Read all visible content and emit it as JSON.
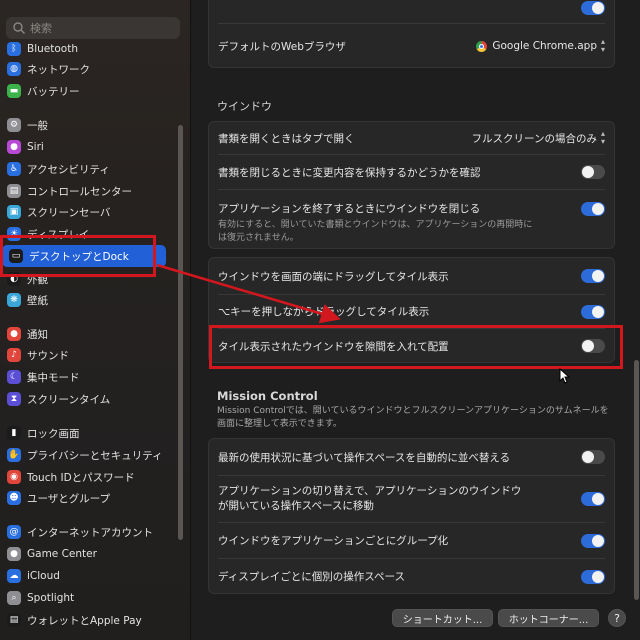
{
  "search": {
    "placeholder": "検索"
  },
  "sidebar": {
    "items": [
      {
        "label": "Bluetooth",
        "icon": "bluetooth-icon",
        "color": "#2a6fe0"
      },
      {
        "label": "ネットワーク",
        "icon": "network-icon",
        "color": "#2a6fe0"
      },
      {
        "label": "バッテリー",
        "icon": "battery-icon",
        "color": "#3cb34a"
      },
      {
        "label": "一般",
        "icon": "gear-icon",
        "color": "#8e8e93"
      },
      {
        "label": "Siri",
        "icon": "siri-icon",
        "color": "#b84ad6"
      },
      {
        "label": "アクセシビリティ",
        "icon": "accessibility-icon",
        "color": "#2a6fe0"
      },
      {
        "label": "コントロールセンター",
        "icon": "control-center-icon",
        "color": "#8e8e93"
      },
      {
        "label": "スクリーンセーバ",
        "icon": "screensaver-icon",
        "color": "#3aa7d8"
      },
      {
        "label": "ディスプレイ",
        "icon": "display-icon",
        "color": "#2a6fe0"
      },
      {
        "label": "デスクトップとDock",
        "icon": "dock-icon",
        "color": "#1b1b1b"
      },
      {
        "label": "外観",
        "icon": "appearance-icon",
        "color": "#1b1b1b"
      },
      {
        "label": "壁紙",
        "icon": "wallpaper-icon",
        "color": "#3aa7d8"
      },
      {
        "label": "通知",
        "icon": "notifications-icon",
        "color": "#e0463b"
      },
      {
        "label": "サウンド",
        "icon": "sound-icon",
        "color": "#e0463b"
      },
      {
        "label": "集中モード",
        "icon": "focus-icon",
        "color": "#5b4fd6"
      },
      {
        "label": "スクリーンタイム",
        "icon": "screentime-icon",
        "color": "#5b4fd6"
      },
      {
        "label": "ロック画面",
        "icon": "lock-screen-icon",
        "color": "#1b1b1b"
      },
      {
        "label": "プライバシーとセキュリティ",
        "icon": "privacy-icon",
        "color": "#2a6fe0"
      },
      {
        "label": "Touch IDとパスワード",
        "icon": "touchid-icon",
        "color": "#e0463b"
      },
      {
        "label": "ユーザとグループ",
        "icon": "users-icon",
        "color": "#2a6fe0"
      },
      {
        "label": "インターネットアカウント",
        "icon": "internet-accounts-icon",
        "color": "#2a6fe0"
      },
      {
        "label": "Game Center",
        "icon": "game-center-icon",
        "color": "#8e8e93"
      },
      {
        "label": "iCloud",
        "icon": "icloud-icon",
        "color": "#2a6fe0"
      },
      {
        "label": "Spotlight",
        "icon": "spotlight-icon",
        "color": "#8e8e93"
      },
      {
        "label": "ウォレットとApple Pay",
        "icon": "wallet-icon",
        "color": "#1b1b1b"
      }
    ]
  },
  "top_group": {
    "browser_label": "デフォルトのWebブラウザ",
    "browser_value": "Google Chrome.app"
  },
  "windows_section": {
    "title": "ウインドウ",
    "open_tabs_label": "書類を開くときはタブで開く",
    "open_tabs_value": "フルスクリーンの場合のみ",
    "ask_keep_changes_label": "書類を閉じるときに変更内容を保持するかどうかを確認",
    "ask_keep_changes": false,
    "close_windows_label": "アプリケーションを終了するときにウインドウを閉じる",
    "close_windows_desc": "有効にすると、開いていた書類とウインドウは、アプリケーションの再開時には復元されません。",
    "close_windows": true
  },
  "tiling": {
    "drag_edge_label": "ウインドウを画面の端にドラッグしてタイル表示",
    "drag_edge": true,
    "option_drag_label": "⌥キーを押しながらドラッグしてタイル表示",
    "option_drag": true,
    "margins_label": "タイル表示されたウインドウを隙間を入れて配置",
    "margins": false
  },
  "mission_control": {
    "title": "Mission Control",
    "desc": "Mission Controlでは、開いているウインドウとフルスクリーンアプリケーションのサムネールを画面に整理して表示できます。",
    "rearrange_label": "最新の使用状況に基づいて操作スペースを自動的に並べ替える",
    "rearrange": false,
    "switch_space_label": "アプリケーションの切り替えで、アプリケーションのウインドウが開いている操作スペースに移動",
    "switch_space": true,
    "group_by_app_label": "ウインドウをアプリケーションごとにグループ化",
    "group_by_app": true,
    "separate_spaces_label": "ディスプレイごとに個別の操作スペース",
    "separate_spaces": true
  },
  "footer": {
    "shortcuts_label": "ショートカット...",
    "hot_corners_label": "ホットコーナー...",
    "help_label": "?"
  },
  "colors": {
    "accent": "#2d6bd8",
    "annotation": "#d3171e",
    "selected": "#2160d6"
  }
}
